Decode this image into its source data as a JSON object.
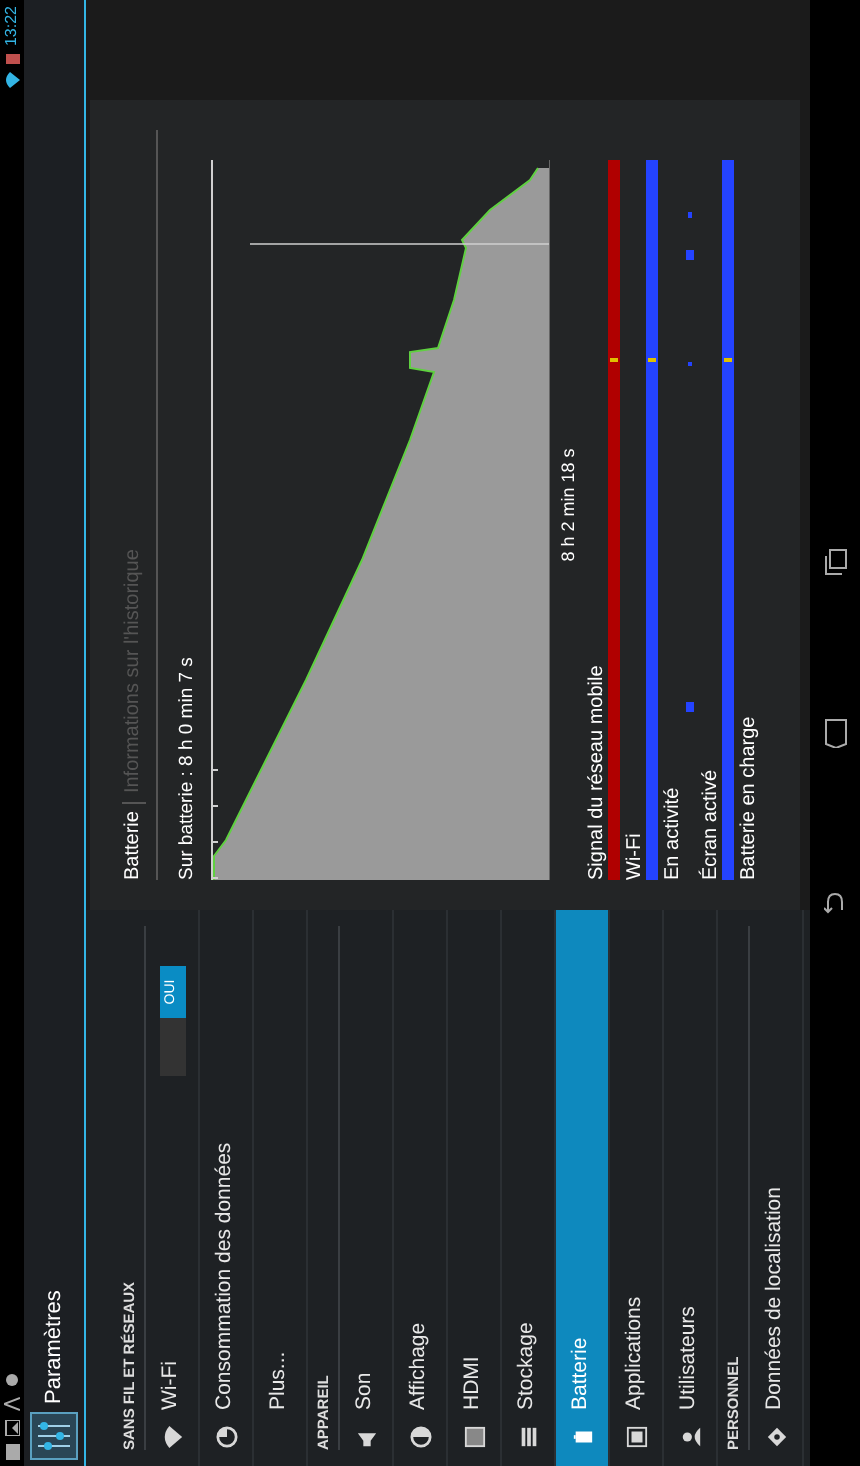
{
  "status_bar": {
    "time": "13:22"
  },
  "action_bar": {
    "title": "Paramètres"
  },
  "settings_list": [
    {
      "kind": "header",
      "label": "SANS FIL ET RÉSEAUX"
    },
    {
      "kind": "item",
      "label": "Wi-Fi",
      "selected": false,
      "toggle": {
        "label": "OUI",
        "on": true
      }
    },
    {
      "kind": "item",
      "label": "Consommation des données",
      "selected": false
    },
    {
      "kind": "item",
      "label": "Plus...",
      "selected": false
    },
    {
      "kind": "header",
      "label": "APPAREIL"
    },
    {
      "kind": "item",
      "label": "Son",
      "selected": false
    },
    {
      "kind": "item",
      "label": "Affichage",
      "selected": false
    },
    {
      "kind": "item",
      "label": "HDMI",
      "selected": false
    },
    {
      "kind": "item",
      "label": "Stockage",
      "selected": false
    },
    {
      "kind": "item",
      "label": "Batterie",
      "selected": true
    },
    {
      "kind": "item",
      "label": "Applications",
      "selected": false
    },
    {
      "kind": "item",
      "label": "Utilisateurs",
      "selected": false
    },
    {
      "kind": "header",
      "label": "PERSONNEL"
    },
    {
      "kind": "item",
      "label": "Données de localisation",
      "selected": false
    }
  ],
  "battery_panel": {
    "title": "Batterie",
    "subtitle": "Informations sur l'historique",
    "summary": "Sur batterie : 8 h 0 min 7 s",
    "duration": "8 h 2 min 18 s",
    "timelines": [
      {
        "label": "Signal du réseau mobile",
        "kind": "full",
        "color": "#b00000"
      },
      {
        "label": "Wi-Fi",
        "kind": "full",
        "color": "#2443ff"
      },
      {
        "label": "En activité",
        "kind": "segments",
        "color": "#2443ff"
      },
      {
        "label": "Écran activé",
        "kind": "full",
        "color": "#2443ff"
      },
      {
        "label": "Batterie en charge",
        "kind": "none"
      }
    ]
  }
}
